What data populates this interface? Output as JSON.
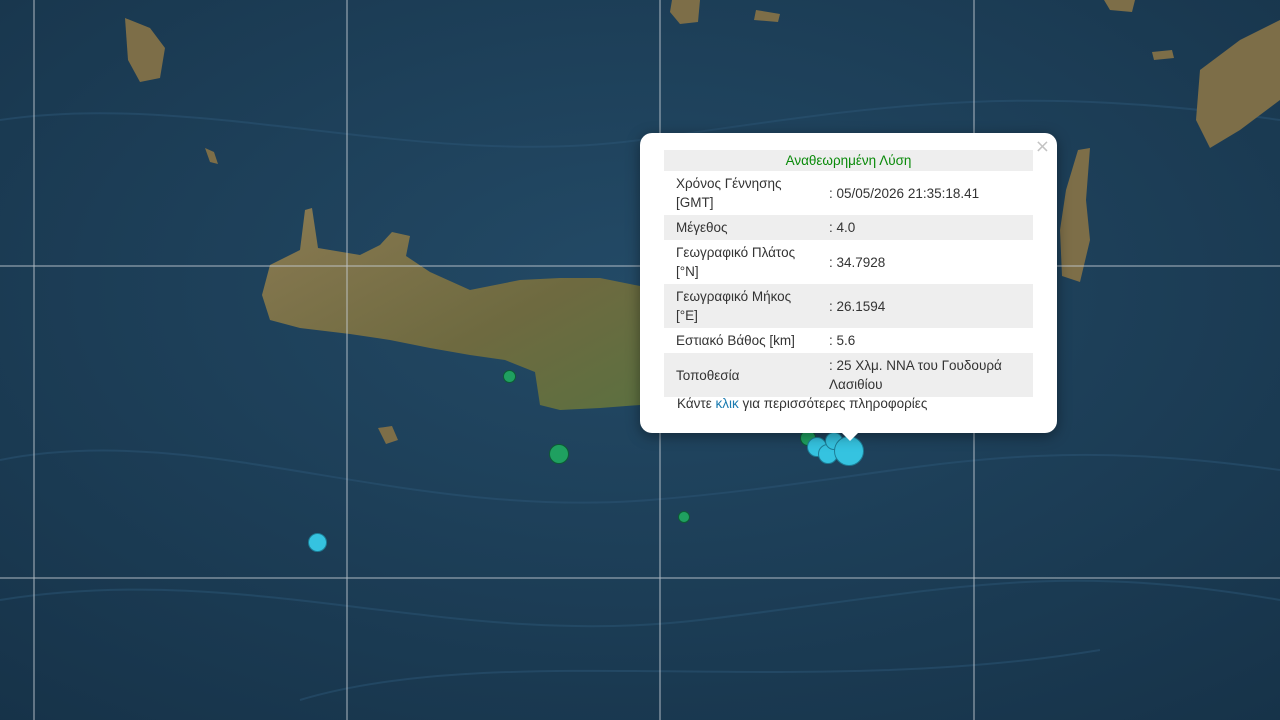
{
  "popup": {
    "title": "Αναθεωρημένη Λύση",
    "close_symbol": "×",
    "rows": [
      {
        "label": "Χρόνος Γέννησης [GMT]",
        "value": ": 05/05/2026 21:35:18.41"
      },
      {
        "label": "Μέγεθος",
        "value": ": 4.0"
      },
      {
        "label": "Γεωγραφικό Πλάτος [°N]",
        "value": ": 34.7928"
      },
      {
        "label": "Γεωγραφικό Μήκος [°E]",
        "value": ": 26.1594"
      },
      {
        "label": "Εστιακό Βάθος [km]",
        "value": ": 5.6"
      },
      {
        "label": "Τοποθεσία",
        "value": ": 25 Χλμ. ΝΝΑ του Γουδουρά Λασιθίου"
      }
    ],
    "footer_before": "Κάντε ",
    "footer_link": "κλικ",
    "footer_after": " για περισσότερες πληροφορίες"
  },
  "colors": {
    "sea": "#1d3e56",
    "land": "#7a6a45",
    "graticule": "#c8cfd6",
    "quake_recent": "#35c3e0",
    "quake_older": "#1fa060",
    "title_green": "#0a8a0a",
    "link_blue": "#1a7bb0"
  }
}
